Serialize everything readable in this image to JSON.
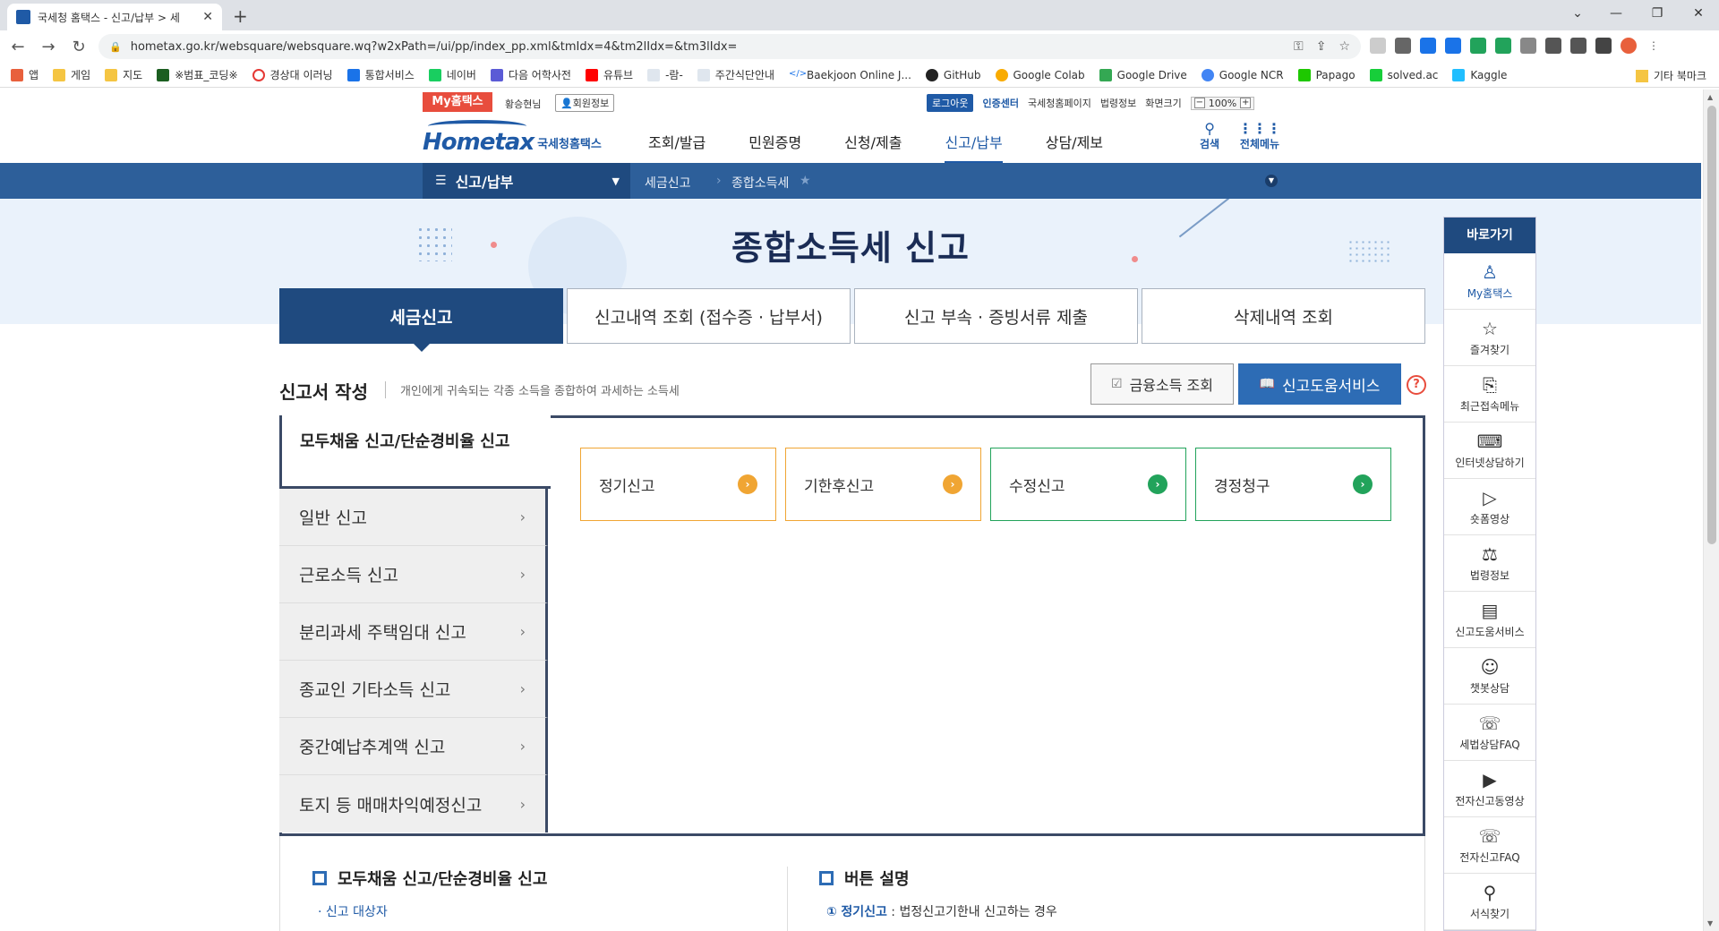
{
  "browser": {
    "tab_title": "국세청 홈택스 - 신고/납부 > 세",
    "tab_close": "✕",
    "new_tab": "+",
    "url": "hometax.go.kr/websquare/websquare.wq?w2xPath=/ui/pp/index_pp.xml&tmIdx=4&tm2lIdx=&tm3lIdx=",
    "bookmarks": [
      "앱",
      "게임",
      "지도",
      "※범표_코딩※",
      "경상대 이러닝",
      "통합서비스",
      "네이버",
      "다음 어학사전",
      "유튜브",
      "-람-",
      "주간식단안내",
      "Baekjoon Online J...",
      "GitHub",
      "Google Colab",
      "Google Drive",
      "Google NCR",
      "Papago",
      "solved.ac",
      "Kaggle"
    ],
    "bookmarks_other": "기타 북마크"
  },
  "util": {
    "my_hometax": "My홈택스",
    "greeting": "황승현님",
    "member_info": "회원정보",
    "logout": "로그아웃",
    "cert_center": "인증센터",
    "links": [
      "국세청홈페이지",
      "법령정보"
    ],
    "screen_size": "화면크기",
    "zoom": "100%"
  },
  "header": {
    "logo_text": "Hometax",
    "logo_kr": "국세청홈택스",
    "gnb": [
      "조회/발급",
      "민원증명",
      "신청/제출",
      "신고/납부",
      "상담/제보"
    ],
    "active_gnb": "신고/납부",
    "search_label": "검색",
    "allmenu_label": "전체메뉴"
  },
  "pathbar": {
    "menu": "신고/납부",
    "crumbs": [
      "세금신고",
      "종합소득세"
    ]
  },
  "hero": {
    "title": "종합소득세 신고"
  },
  "tabs": [
    "세금신고",
    "신고내역 조회 (접수증 · 납부서)",
    "신고 부속 · 증빙서류 제출",
    "삭제내역 조회"
  ],
  "section": {
    "title": "신고서 작성",
    "desc": "개인에게 귀속되는 각종 소득을 종합하여 과세하는 소득세",
    "btn_finance": "금융소득 조회",
    "btn_help": "신고도움서비스",
    "help_mark": "?"
  },
  "sidemenu": {
    "active": "모두채움 신고/단순경비율 신고",
    "items": [
      "일반 신고",
      "근로소득 신고",
      "분리과세 주택임대 신고",
      "종교인 기타소득 신고",
      "중간예납추계액 신고",
      "토지 등 매매차익예정신고"
    ]
  },
  "cards": [
    {
      "label": "정기신고",
      "color": "#f0a533"
    },
    {
      "label": "기한후신고",
      "color": "#f0a533"
    },
    {
      "label": "수정신고",
      "color": "#22a35b"
    },
    {
      "label": "경정청구",
      "color": "#22a35b"
    }
  ],
  "info": {
    "left_title": "모두채움 신고/단순경비율 신고",
    "left_sub": "· 신고 대상자",
    "right_title": "버튼 설명",
    "right_num": "①",
    "right_key": "정기신고",
    "right_text": " : 법정신고기한내 신고하는 경우"
  },
  "quick": {
    "title": "바로가기",
    "items": [
      {
        "label": "My홈택스",
        "icon": "person-icon"
      },
      {
        "label": "즐겨찾기",
        "icon": "star-icon"
      },
      {
        "label": "최근접속메뉴",
        "icon": "recent-icon"
      },
      {
        "label": "인터넷상담하기",
        "icon": "laptop-icon"
      },
      {
        "label": "숏폼영상",
        "icon": "play-icon"
      },
      {
        "label": "법령정보",
        "icon": "gavel-icon"
      },
      {
        "label": "신고도움서비스",
        "icon": "book-icon"
      },
      {
        "label": "챗봇상담",
        "icon": "chatbot-icon"
      },
      {
        "label": "세법상담FAQ",
        "icon": "faq-icon"
      },
      {
        "label": "전자신고동영상",
        "icon": "video-icon"
      },
      {
        "label": "전자신고FAQ",
        "icon": "faq-icon"
      },
      {
        "label": "서식찾기",
        "icon": "search-icon"
      }
    ]
  }
}
